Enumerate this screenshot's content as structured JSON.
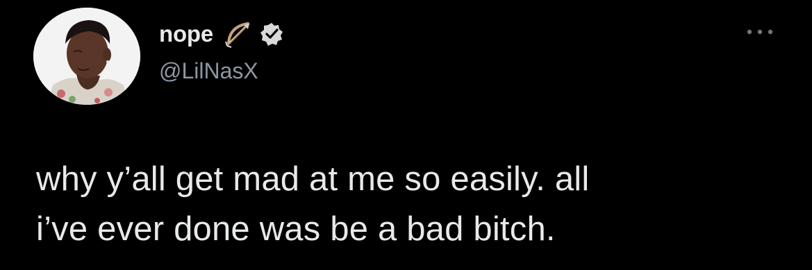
{
  "tweet": {
    "author": {
      "display_name": "nope",
      "display_name_emoji": "bow-and-arrow-icon",
      "handle": "@LilNasX",
      "verified": true,
      "avatar": "profile-photo"
    },
    "text_lines": [
      "why y’all get mad at me so easily. all",
      "i’ve ever done was be a bad bitch."
    ],
    "menu_icon": "more-options-icon"
  },
  "colors": {
    "background": "#000000",
    "primary_text": "#e7e9ea",
    "secondary_text": "#8b98a5",
    "verified_badge": "#d9d9d9"
  }
}
